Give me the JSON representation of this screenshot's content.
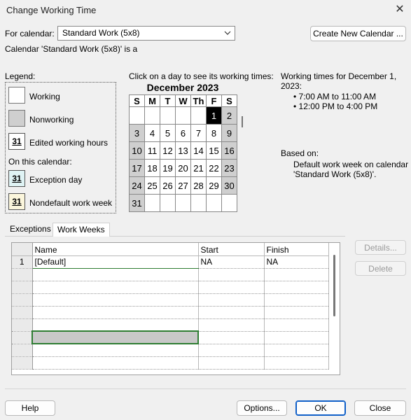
{
  "window": {
    "title": "Change Working Time",
    "close_glyph": "✕"
  },
  "for_calendar": {
    "label": "For calendar:",
    "selected": "Standard Work (5x8)",
    "create_new_button": "Create New Calendar ..."
  },
  "info_line": "Calendar 'Standard Work (5x8)' is a",
  "legend": {
    "title": "Legend:",
    "working": "Working",
    "nonworking": "Nonworking",
    "edited_hours": "Edited working hours",
    "on_this_calendar": "On this calendar:",
    "exception_day": "Exception day",
    "nondefault_week": "Nondefault work week",
    "swatch_number": "31"
  },
  "calendar": {
    "instruction": "Click on a day to see its working times:",
    "month_title": "December 2023",
    "day_headers": [
      "S",
      "M",
      "T",
      "W",
      "Th",
      "F",
      "S"
    ],
    "weeks": [
      [
        "",
        "",
        "",
        "",
        "",
        "1",
        "2"
      ],
      [
        "3",
        "4",
        "5",
        "6",
        "7",
        "8",
        "9"
      ],
      [
        "10",
        "11",
        "12",
        "13",
        "14",
        "15",
        "16"
      ],
      [
        "17",
        "18",
        "19",
        "20",
        "21",
        "22",
        "23"
      ],
      [
        "24",
        "25",
        "26",
        "27",
        "28",
        "29",
        "30"
      ],
      [
        "31",
        "",
        "",
        "",
        "",
        "",
        ""
      ]
    ],
    "selected_day": "1"
  },
  "working_times": {
    "heading": "Working times for December 1, 2023:",
    "ranges": [
      "7:00 AM to 11:00 AM",
      "12:00 PM to 4:00 PM"
    ],
    "based_on_label": "Based on:",
    "based_on_text": "Default work week on calendar 'Standard Work (5x8)'."
  },
  "tabs": [
    {
      "label": "Exceptions",
      "active": false
    },
    {
      "label": "Work Weeks",
      "active": true
    }
  ],
  "work_weeks_table": {
    "columns": [
      "Name",
      "Start",
      "Finish"
    ],
    "rows": [
      {
        "num": "1",
        "name": "[Default]",
        "start": "NA",
        "finish": "NA"
      }
    ],
    "empty_rows": 8
  },
  "side_buttons": {
    "details": "Details...",
    "delete": "Delete"
  },
  "footer": {
    "help": "Help",
    "options": "Options...",
    "ok": "OK",
    "close": "Close"
  }
}
